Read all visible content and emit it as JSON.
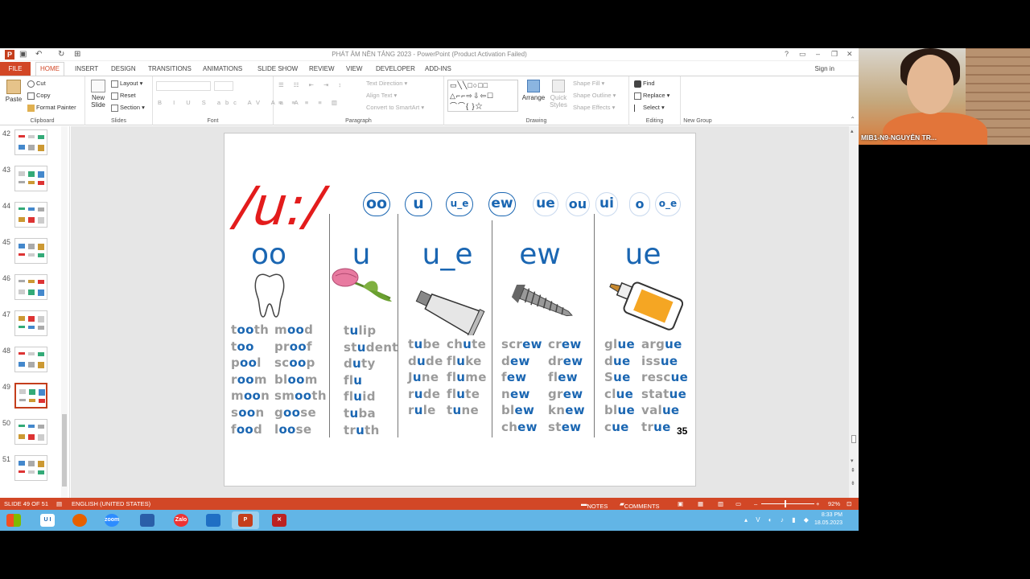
{
  "window": {
    "title": "PHÁT ÂM NỀN TẢNG 2023 - PowerPoint (Product Activation Failed)",
    "sign_in": "Sign in"
  },
  "tabs": [
    "FILE",
    "HOME",
    "INSERT",
    "DESIGN",
    "TRANSITIONS",
    "ANIMATIONS",
    "SLIDE SHOW",
    "REVIEW",
    "VIEW",
    "DEVELOPER",
    "ADD-INS"
  ],
  "ribbon": {
    "clipboard": {
      "label": "Clipboard",
      "paste": "Paste",
      "cut": "Cut",
      "copy": "Copy",
      "format_painter": "Format Painter"
    },
    "slides": {
      "label": "Slides",
      "new_slide": "New Slide",
      "layout": "Layout",
      "reset": "Reset",
      "section": "Section"
    },
    "font": {
      "label": "Font"
    },
    "paragraph": {
      "label": "Paragraph",
      "text_direction": "Text Direction",
      "align_text": "Align Text",
      "convert_smartart": "Convert to SmartArt"
    },
    "drawing": {
      "label": "Drawing",
      "arrange": "Arrange",
      "quick_styles": "Quick Styles",
      "shape_fill": "Shape Fill",
      "shape_outline": "Shape Outline",
      "shape_effects": "Shape Effects"
    },
    "editing": {
      "label": "Editing",
      "find": "Find",
      "replace": "Replace",
      "select": "Select"
    },
    "new_group": {
      "label": "New Group"
    }
  },
  "thumbnails": [
    "42",
    "43",
    "44",
    "45",
    "46",
    "47",
    "48",
    "49",
    "50",
    "51"
  ],
  "selected_thumbnail": "49",
  "slide": {
    "sound": "/u:/",
    "spellings": [
      "oo",
      "u",
      "u_e",
      "ew",
      "ue",
      "ou",
      "ui",
      "o",
      "o_e"
    ],
    "columns": [
      {
        "head": "oo",
        "words": [
          [
            "t",
            "oo",
            "th"
          ],
          [
            "m",
            "oo",
            "d"
          ],
          [
            "t",
            "oo",
            ""
          ],
          [
            "pr",
            "oo",
            "f"
          ],
          [
            "p",
            "oo",
            "l"
          ],
          [
            "sc",
            "oo",
            "p"
          ],
          [
            "r",
            "oo",
            "m"
          ],
          [
            "bl",
            "oo",
            "m"
          ],
          [
            "m",
            "oo",
            "n"
          ],
          [
            "sm",
            "oo",
            "th"
          ],
          [
            "s",
            "oo",
            "n"
          ],
          [
            "g",
            "oo",
            "se"
          ],
          [
            "f",
            "oo",
            "d"
          ],
          [
            "l",
            "oo",
            "se"
          ]
        ]
      },
      {
        "head": "u",
        "words": [
          [
            "t",
            "u",
            "lip"
          ],
          [
            "st",
            "u",
            "dent"
          ],
          [
            "d",
            "u",
            "ty"
          ],
          [
            "fl",
            "u",
            ""
          ],
          [
            "fl",
            "u",
            "id"
          ],
          [
            "t",
            "u",
            "ba"
          ],
          [
            "tr",
            "u",
            "th"
          ]
        ]
      },
      {
        "head": "u_e",
        "words": [
          [
            "t",
            "u",
            "be"
          ],
          [
            "ch",
            "u",
            "te"
          ],
          [
            "d",
            "u",
            "de"
          ],
          [
            "fl",
            "u",
            "ke"
          ],
          [
            "J",
            "u",
            "ne"
          ],
          [
            "fl",
            "u",
            "me"
          ],
          [
            "r",
            "u",
            "de"
          ],
          [
            "fl",
            "u",
            "te"
          ],
          [
            "r",
            "u",
            "le"
          ],
          [
            "t",
            "u",
            "ne"
          ]
        ]
      },
      {
        "head": "ew",
        "words": [
          [
            "scr",
            "ew",
            ""
          ],
          [
            "cr",
            "ew",
            ""
          ],
          [
            "d",
            "ew",
            ""
          ],
          [
            "dr",
            "ew",
            ""
          ],
          [
            "f",
            "ew",
            ""
          ],
          [
            "fl",
            "ew",
            ""
          ],
          [
            "n",
            "ew",
            ""
          ],
          [
            "gr",
            "ew",
            ""
          ],
          [
            "bl",
            "ew",
            ""
          ],
          [
            "kn",
            "ew",
            ""
          ],
          [
            "ch",
            "ew",
            ""
          ],
          [
            "st",
            "ew",
            ""
          ]
        ]
      },
      {
        "head": "ue",
        "words": [
          [
            "gl",
            "ue",
            ""
          ],
          [
            "arg",
            "ue",
            ""
          ],
          [
            "d",
            "ue",
            ""
          ],
          [
            "iss",
            "ue",
            ""
          ],
          [
            "S",
            "ue",
            ""
          ],
          [
            "resc",
            "ue",
            ""
          ],
          [
            "cl",
            "ue",
            ""
          ],
          [
            "stat",
            "ue",
            ""
          ],
          [
            "bl",
            "ue",
            ""
          ],
          [
            "val",
            "ue",
            ""
          ],
          [
            "c",
            "ue",
            ""
          ],
          [
            "tr",
            "ue",
            ""
          ]
        ]
      }
    ],
    "page_number": "35"
  },
  "status_bar": {
    "slide_info": "SLIDE 49 OF 51",
    "language": "ENGLISH (UNITED STATES)",
    "notes": "NOTES",
    "comments": "COMMENTS",
    "zoom": "92%"
  },
  "taskbar": {
    "time": "8:33 PM",
    "date": "18.05.2023"
  },
  "webcam": {
    "name": "MIB1-N9-NGUYỄN TR..."
  },
  "colors": {
    "accent": "#d24726",
    "vowel_blue": "#1a66b2",
    "sound_red": "#e31c1c",
    "taskbar": "#62b5e6"
  }
}
